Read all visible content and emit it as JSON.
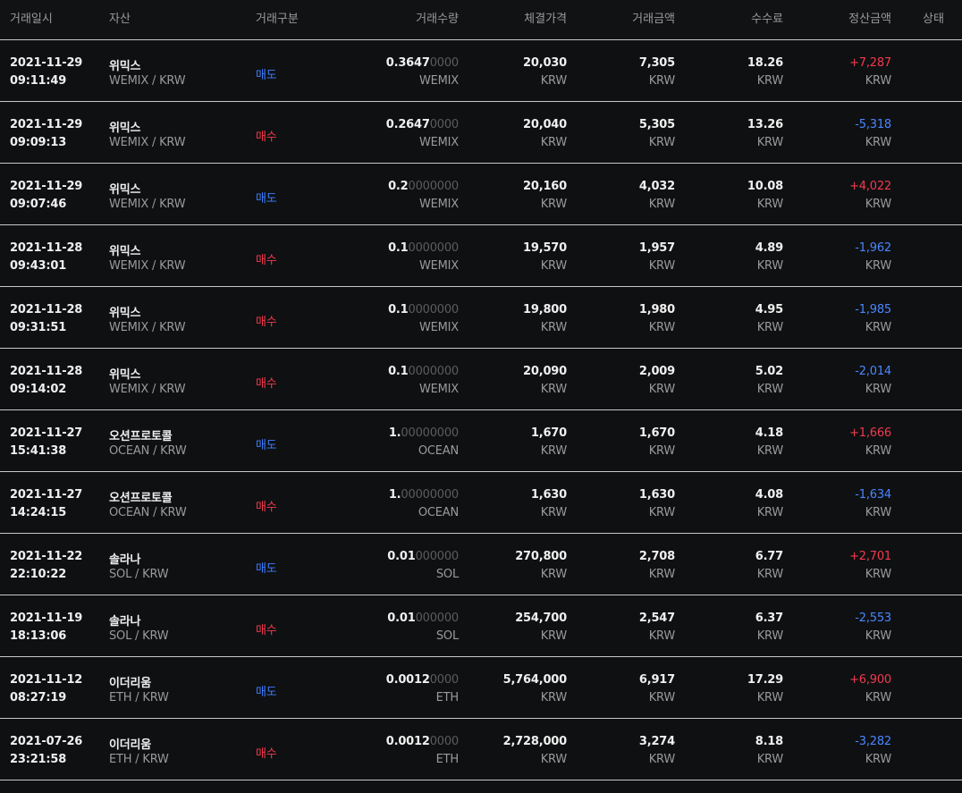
{
  "header": {
    "datetime": "거래일시",
    "asset": "자산",
    "side": "거래구분",
    "qty": "거래수량",
    "price": "체결가격",
    "amount": "거래금액",
    "fee": "수수료",
    "settle": "정산금액",
    "status": "상태"
  },
  "colors": {
    "sell": "#3d7dff",
    "buy": "#f23a4e",
    "positive": "#f23a4e",
    "negative": "#4a86ff"
  },
  "rows": [
    {
      "date": "2021-11-29",
      "time": "09:11:49",
      "name": "위믹스",
      "pair": "WEMIX / KRW",
      "side": "매도",
      "side_type": "sell",
      "qty_main": "0.3647",
      "qty_dim": "0000",
      "qty_unit": "WEMIX",
      "price": "20,030",
      "price_unit": "KRW",
      "amount": "7,305",
      "amount_unit": "KRW",
      "fee": "18.26",
      "fee_unit": "KRW",
      "settle": "+7,287",
      "settle_sign": "pos",
      "settle_unit": "KRW"
    },
    {
      "date": "2021-11-29",
      "time": "09:09:13",
      "name": "위믹스",
      "pair": "WEMIX / KRW",
      "side": "매수",
      "side_type": "buy",
      "qty_main": "0.2647",
      "qty_dim": "0000",
      "qty_unit": "WEMIX",
      "price": "20,040",
      "price_unit": "KRW",
      "amount": "5,305",
      "amount_unit": "KRW",
      "fee": "13.26",
      "fee_unit": "KRW",
      "settle": "-5,318",
      "settle_sign": "neg",
      "settle_unit": "KRW"
    },
    {
      "date": "2021-11-29",
      "time": "09:07:46",
      "name": "위믹스",
      "pair": "WEMIX / KRW",
      "side": "매도",
      "side_type": "sell",
      "qty_main": "0.2",
      "qty_dim": "0000000",
      "qty_unit": "WEMIX",
      "price": "20,160",
      "price_unit": "KRW",
      "amount": "4,032",
      "amount_unit": "KRW",
      "fee": "10.08",
      "fee_unit": "KRW",
      "settle": "+4,022",
      "settle_sign": "pos",
      "settle_unit": "KRW"
    },
    {
      "date": "2021-11-28",
      "time": "09:43:01",
      "name": "위믹스",
      "pair": "WEMIX / KRW",
      "side": "매수",
      "side_type": "buy",
      "qty_main": "0.1",
      "qty_dim": "0000000",
      "qty_unit": "WEMIX",
      "price": "19,570",
      "price_unit": "KRW",
      "amount": "1,957",
      "amount_unit": "KRW",
      "fee": "4.89",
      "fee_unit": "KRW",
      "settle": "-1,962",
      "settle_sign": "neg",
      "settle_unit": "KRW"
    },
    {
      "date": "2021-11-28",
      "time": "09:31:51",
      "name": "위믹스",
      "pair": "WEMIX / KRW",
      "side": "매수",
      "side_type": "buy",
      "qty_main": "0.1",
      "qty_dim": "0000000",
      "qty_unit": "WEMIX",
      "price": "19,800",
      "price_unit": "KRW",
      "amount": "1,980",
      "amount_unit": "KRW",
      "fee": "4.95",
      "fee_unit": "KRW",
      "settle": "-1,985",
      "settle_sign": "neg",
      "settle_unit": "KRW"
    },
    {
      "date": "2021-11-28",
      "time": "09:14:02",
      "name": "위믹스",
      "pair": "WEMIX / KRW",
      "side": "매수",
      "side_type": "buy",
      "qty_main": "0.1",
      "qty_dim": "0000000",
      "qty_unit": "WEMIX",
      "price": "20,090",
      "price_unit": "KRW",
      "amount": "2,009",
      "amount_unit": "KRW",
      "fee": "5.02",
      "fee_unit": "KRW",
      "settle": "-2,014",
      "settle_sign": "neg",
      "settle_unit": "KRW"
    },
    {
      "date": "2021-11-27",
      "time": "15:41:38",
      "name": "오션프로토콜",
      "pair": "OCEAN / KRW",
      "side": "매도",
      "side_type": "sell",
      "qty_main": "1.",
      "qty_dim": "00000000",
      "qty_unit": "OCEAN",
      "price": "1,670",
      "price_unit": "KRW",
      "amount": "1,670",
      "amount_unit": "KRW",
      "fee": "4.18",
      "fee_unit": "KRW",
      "settle": "+1,666",
      "settle_sign": "pos",
      "settle_unit": "KRW"
    },
    {
      "date": "2021-11-27",
      "time": "14:24:15",
      "name": "오션프로토콜",
      "pair": "OCEAN / KRW",
      "side": "매수",
      "side_type": "buy",
      "qty_main": "1.",
      "qty_dim": "00000000",
      "qty_unit": "OCEAN",
      "price": "1,630",
      "price_unit": "KRW",
      "amount": "1,630",
      "amount_unit": "KRW",
      "fee": "4.08",
      "fee_unit": "KRW",
      "settle": "-1,634",
      "settle_sign": "neg",
      "settle_unit": "KRW"
    },
    {
      "date": "2021-11-22",
      "time": "22:10:22",
      "name": "솔라나",
      "pair": "SOL / KRW",
      "side": "매도",
      "side_type": "sell",
      "qty_main": "0.01",
      "qty_dim": "000000",
      "qty_unit": "SOL",
      "price": "270,800",
      "price_unit": "KRW",
      "amount": "2,708",
      "amount_unit": "KRW",
      "fee": "6.77",
      "fee_unit": "KRW",
      "settle": "+2,701",
      "settle_sign": "pos",
      "settle_unit": "KRW"
    },
    {
      "date": "2021-11-19",
      "time": "18:13:06",
      "name": "솔라나",
      "pair": "SOL / KRW",
      "side": "매수",
      "side_type": "buy",
      "qty_main": "0.01",
      "qty_dim": "000000",
      "qty_unit": "SOL",
      "price": "254,700",
      "price_unit": "KRW",
      "amount": "2,547",
      "amount_unit": "KRW",
      "fee": "6.37",
      "fee_unit": "KRW",
      "settle": "-2,553",
      "settle_sign": "neg",
      "settle_unit": "KRW"
    },
    {
      "date": "2021-11-12",
      "time": "08:27:19",
      "name": "이더리움",
      "pair": "ETH / KRW",
      "side": "매도",
      "side_type": "sell",
      "qty_main": "0.0012",
      "qty_dim": "0000",
      "qty_unit": "ETH",
      "price": "5,764,000",
      "price_unit": "KRW",
      "amount": "6,917",
      "amount_unit": "KRW",
      "fee": "17.29",
      "fee_unit": "KRW",
      "settle": "+6,900",
      "settle_sign": "pos",
      "settle_unit": "KRW"
    },
    {
      "date": "2021-07-26",
      "time": "23:21:58",
      "name": "이더리움",
      "pair": "ETH / KRW",
      "side": "매수",
      "side_type": "buy",
      "qty_main": "0.0012",
      "qty_dim": "0000",
      "qty_unit": "ETH",
      "price": "2,728,000",
      "price_unit": "KRW",
      "amount": "3,274",
      "amount_unit": "KRW",
      "fee": "8.18",
      "fee_unit": "KRW",
      "settle": "-3,282",
      "settle_sign": "neg",
      "settle_unit": "KRW"
    }
  ]
}
